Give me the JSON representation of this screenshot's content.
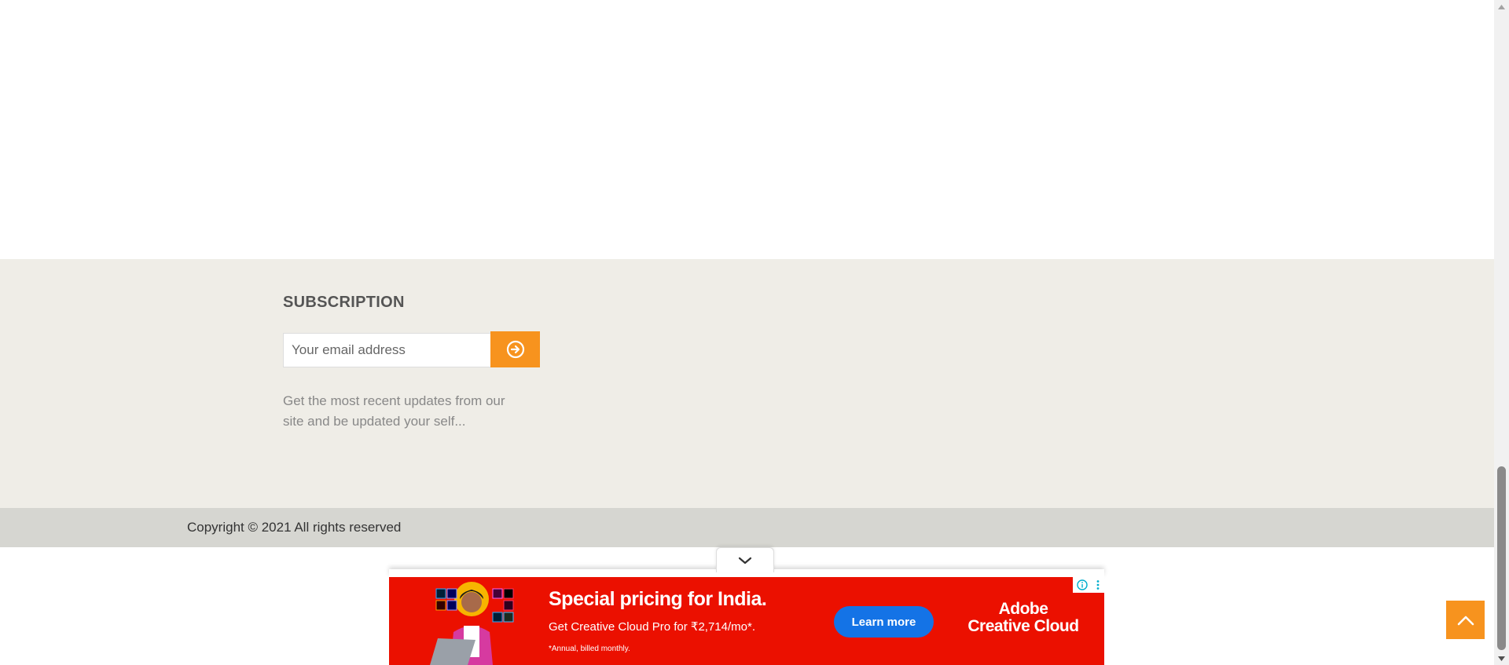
{
  "subscription": {
    "title": "SUBSCRIPTION",
    "email_placeholder": "Your email address",
    "submit_icon": "arrow-circle-right-icon",
    "description": "Get the most recent updates from our site and be updated your self..."
  },
  "footer": {
    "copyright": "Copyright © 2021 All rights reserved"
  },
  "ad": {
    "collapse_icon": "chevron-down-icon",
    "headline": "Special pricing for India.",
    "subtext": "Get Creative Cloud Pro for ₹2,714/mo*.",
    "note": "*Annual, billed monthly.",
    "cta_label": "Learn more",
    "brand_line1": "Adobe",
    "brand_line2": "Creative Cloud",
    "info_icon": "info-icon",
    "menu_icon": "more-vertical-icon",
    "background_color": "#eb1000",
    "cta_color": "#1473e6"
  },
  "scroll_to_top": {
    "icon": "chevron-up-icon",
    "color": "#f7931e"
  },
  "accent_color": "#f7931e"
}
